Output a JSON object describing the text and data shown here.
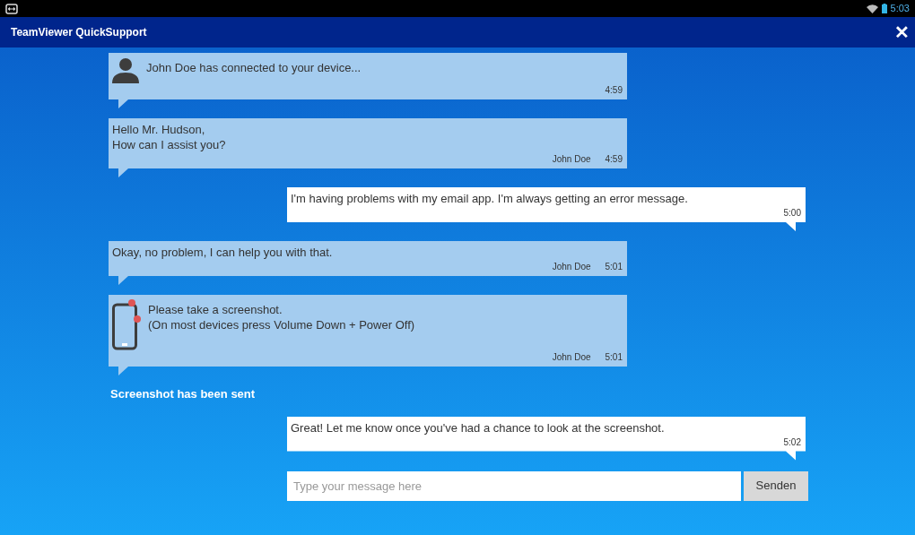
{
  "status_bar": {
    "time": "5:03"
  },
  "window": {
    "title": "TeamViewer QuickSupport",
    "close": "✕"
  },
  "messages": [
    {
      "kind": "connection",
      "lines": [
        "John Doe has connected to your device..."
      ],
      "time": "4:59"
    },
    {
      "kind": "incoming",
      "lines": [
        "Hello Mr. Hudson,",
        "How can I assist you?"
      ],
      "sender": "John Doe",
      "time": "4:59"
    },
    {
      "kind": "outgoing",
      "lines": [
        "I'm having problems with my email app. I'm always getting an error message."
      ],
      "time": "5:00"
    },
    {
      "kind": "incoming",
      "lines": [
        "Okay, no problem, I can help you with that."
      ],
      "sender": "John Doe",
      "time": "5:01"
    },
    {
      "kind": "instruction",
      "lines": [
        "Please take a screenshot.",
        "(On most devices press Volume Down + Power Off)"
      ],
      "sender": "John Doe",
      "time": "5:01"
    },
    {
      "kind": "note",
      "lines": [
        "Screenshot has been sent"
      ]
    },
    {
      "kind": "outgoing",
      "lines": [
        "Great! Let me know once you've had a chance to look at the screenshot."
      ],
      "time": "5:02"
    }
  ],
  "composer": {
    "placeholder": "Type your message here",
    "send": "Senden"
  }
}
